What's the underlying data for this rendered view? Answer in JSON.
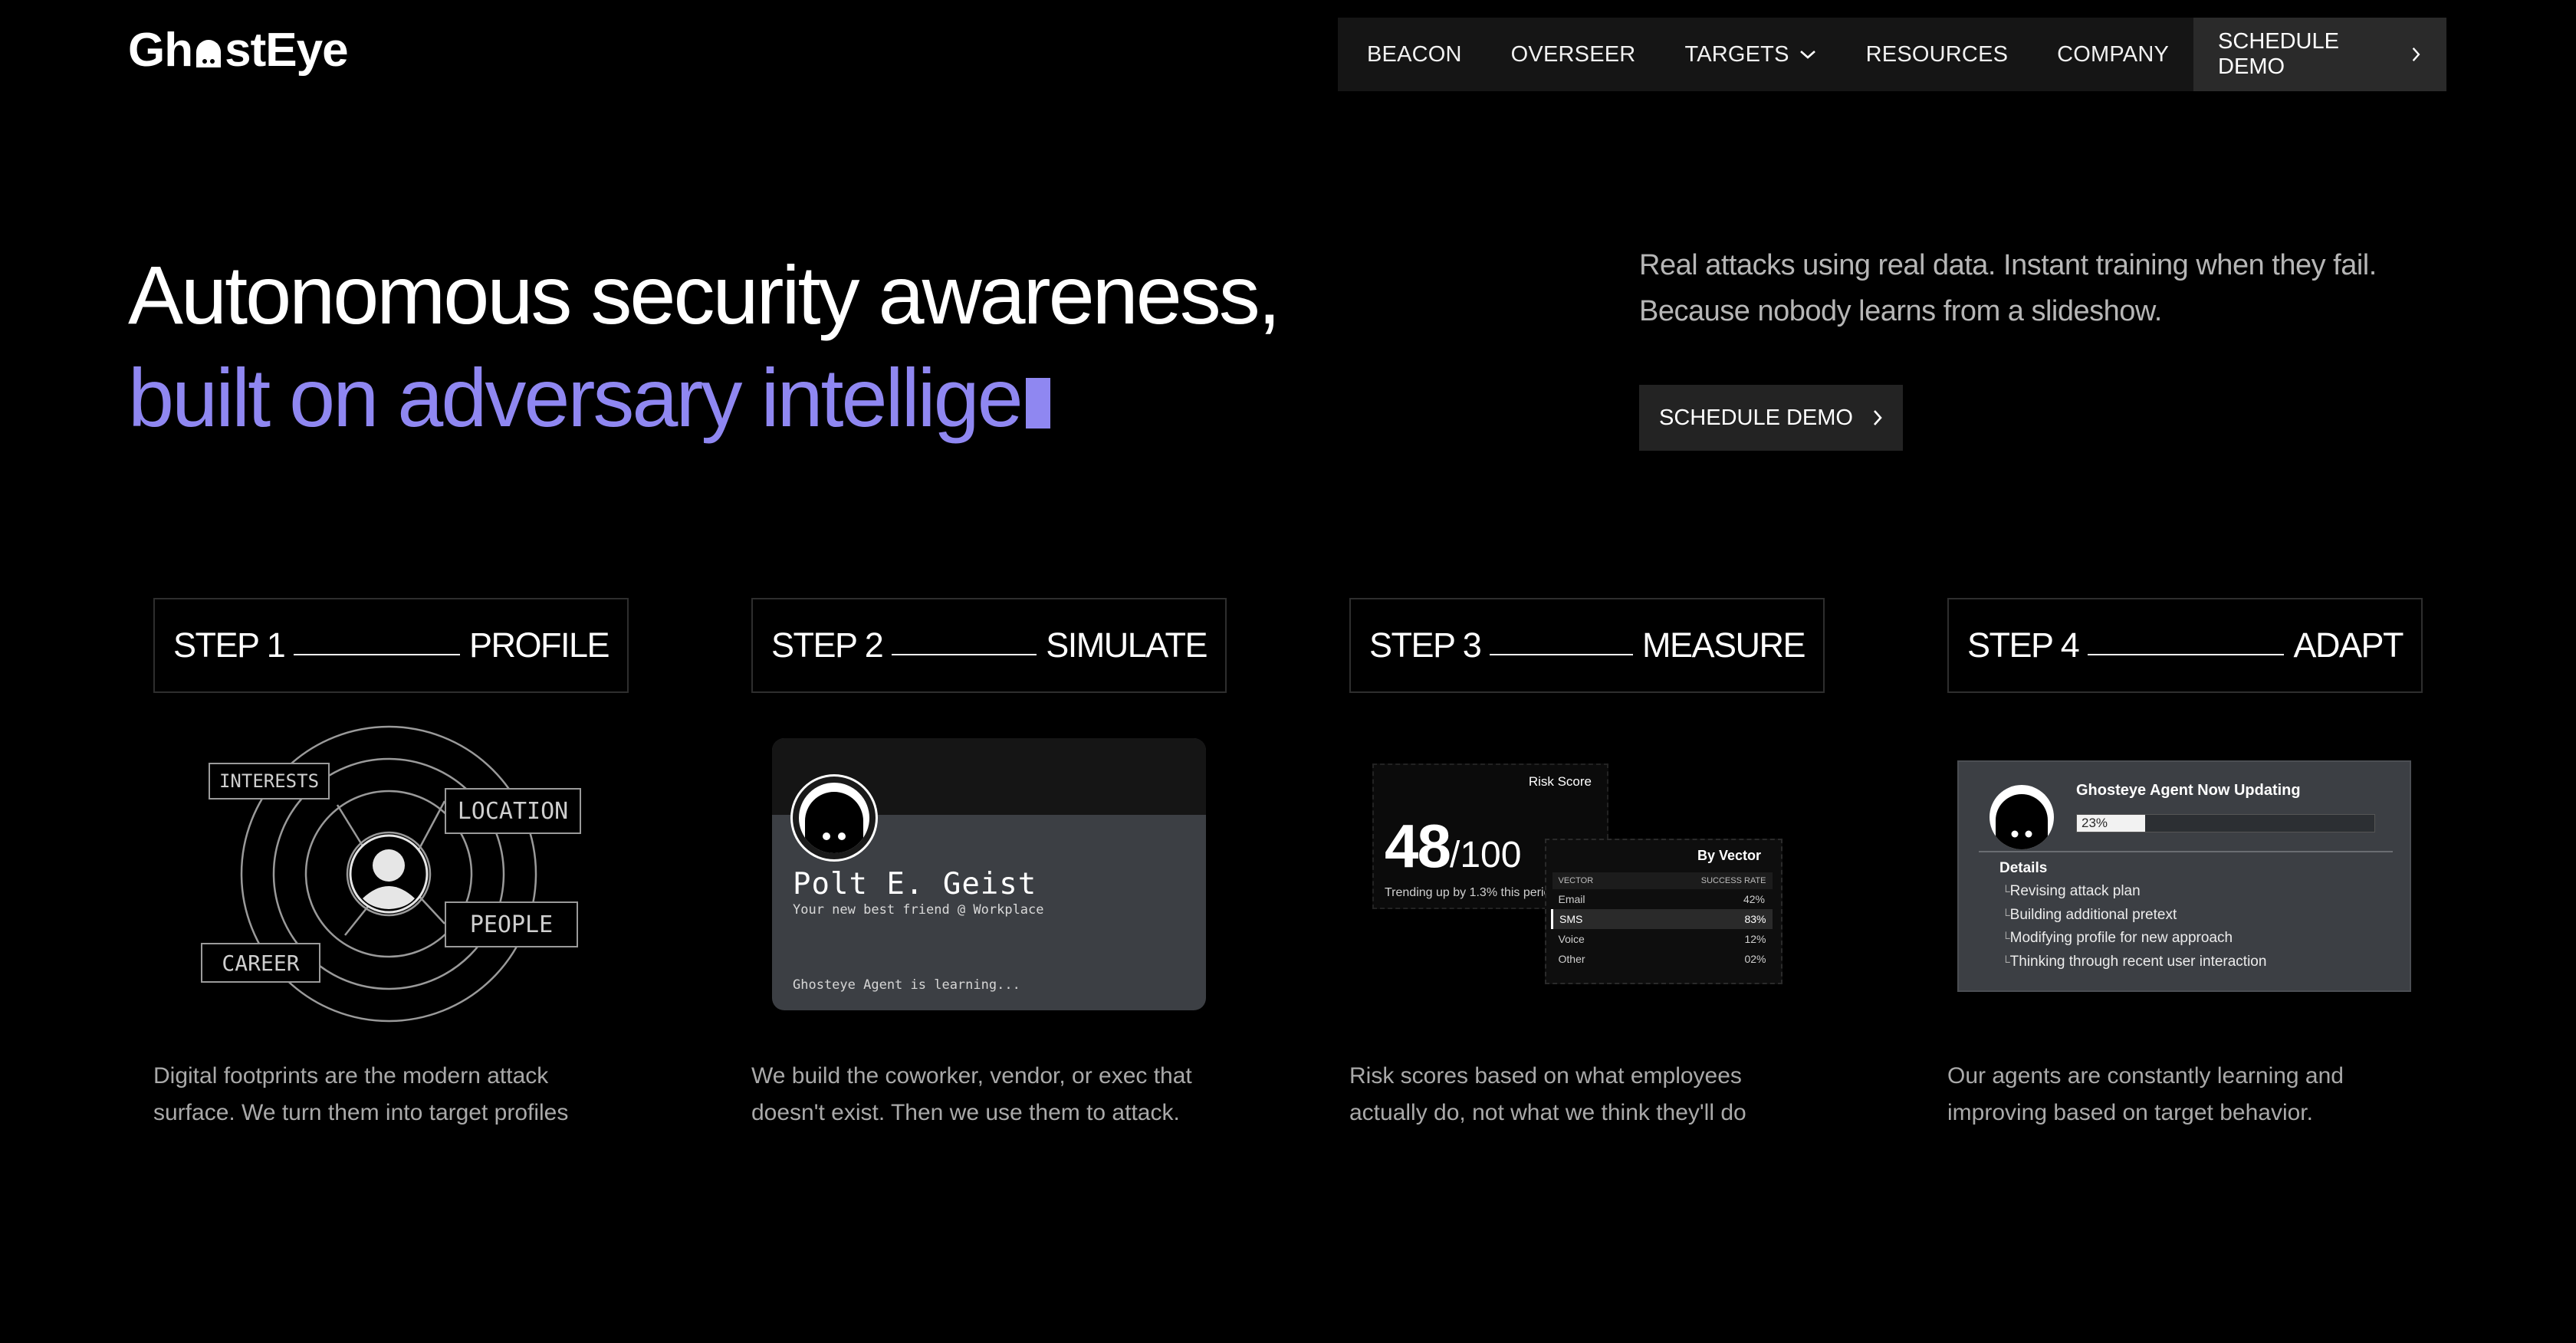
{
  "brand": {
    "logo_left": "Gh",
    "logo_right": "stEye"
  },
  "nav": {
    "items": [
      "BEACON",
      "OVERSEER",
      "TARGETS",
      "RESOURCES",
      "COMPANY"
    ],
    "cta": "SCHEDULE DEMO"
  },
  "hero": {
    "line1": "Autonomous security awareness,",
    "line2": "built on adversary intellige",
    "subtitle": "Real attacks using real data. Instant training when they fail. Because nobody learns from a slideshow.",
    "cta": "SCHEDULE DEMO"
  },
  "steps": [
    {
      "label": "STEP 1",
      "name": "PROFILE",
      "description": "Digital footprints are the modern attack surface. We turn them into target profiles"
    },
    {
      "label": "STEP 2",
      "name": "SIMULATE",
      "description": "We build the coworker, vendor, or exec that doesn't exist. Then we use them to attack."
    },
    {
      "label": "STEP 3",
      "name": "MEASURE",
      "description": "Risk scores based on what employees actually do, not what we think they'll do"
    },
    {
      "label": "STEP 4",
      "name": "ADAPT",
      "description": "Our agents are constantly learning and improving based on target behavior."
    }
  ],
  "profile_diagram": {
    "tags": [
      "INTERESTS",
      "LOCATION",
      "PEOPLE",
      "CAREER"
    ]
  },
  "persona_card": {
    "name": "Polt E. Geist",
    "tagline": "Your new best friend @ Workplace",
    "status": "Ghosteye Agent is learning..."
  },
  "risk_card": {
    "label": "Risk Score",
    "score": "48",
    "out_of": "/100",
    "trend": "Trending up by 1.3% this period"
  },
  "vector_card": {
    "title": "By Vector",
    "headers": [
      "VECTOR",
      "SUCCESS RATE"
    ],
    "rows": [
      {
        "vector": "Email",
        "rate": "42%"
      },
      {
        "vector": "SMS",
        "rate": "83%"
      },
      {
        "vector": "Voice",
        "rate": "12%"
      },
      {
        "vector": "Other",
        "rate": "02%"
      }
    ],
    "highlighted_row": 1
  },
  "agent_card": {
    "title": "Ghosteye Agent Now Updating",
    "progress_label": "23%",
    "progress": 0.23,
    "details_label": "Details",
    "details": [
      "Revising attack plan",
      "Building additional pretext",
      "Modifying profile for new approach",
      "Thinking through recent user interaction"
    ]
  },
  "colors": {
    "accent": "#8f87f1",
    "background": "#000000",
    "nav_bg": "#151515"
  },
  "icons": {
    "chevron_down": "chevron-down-icon",
    "chevron_right": "chevron-right-icon"
  }
}
